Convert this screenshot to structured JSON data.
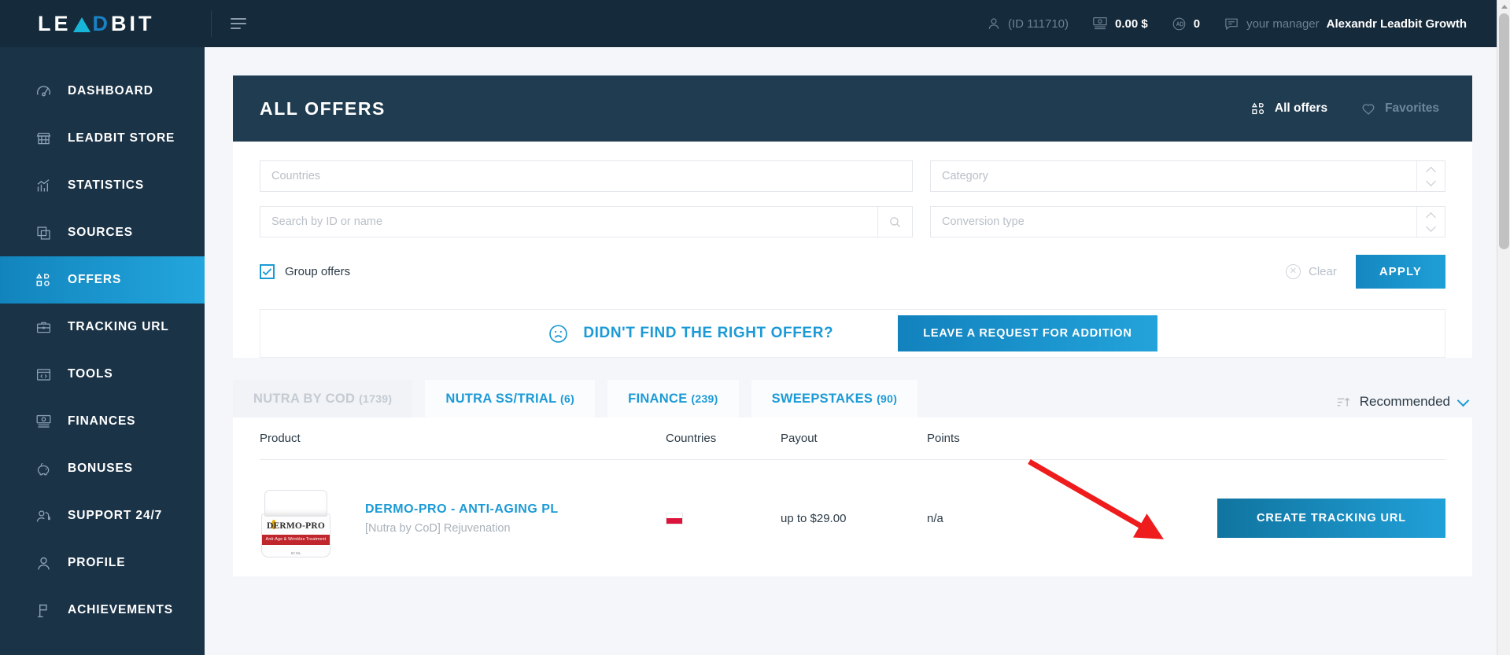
{
  "brand": {
    "name": "LEADBIT",
    "accent": "#17b6d8",
    "accent2": "#1a81c4"
  },
  "topbar": {
    "user_id": "(ID 111710)",
    "balance": "0.00 $",
    "points": "0",
    "manager_label": "your manager",
    "manager_name": "Alexandr Leadbit Growth",
    "icons": {
      "user": "user-icon",
      "money": "banknote-icon",
      "points": "points-icon",
      "chat": "chat-icon",
      "menu": "hamburger-icon"
    }
  },
  "sidebar": {
    "items": [
      {
        "label": "DASHBOARD",
        "icon": "gauge-icon",
        "active": false
      },
      {
        "label": "LEADBIT STORE",
        "icon": "store-icon",
        "active": false
      },
      {
        "label": "STATISTICS",
        "icon": "bar-chart-icon",
        "active": false
      },
      {
        "label": "SOURCES",
        "icon": "layers-icon",
        "active": false
      },
      {
        "label": "OFFERS",
        "icon": "shapes-icon",
        "active": true
      },
      {
        "label": "TRACKING URL",
        "icon": "briefcase-icon",
        "active": false
      },
      {
        "label": "TOOLS",
        "icon": "code-window-icon",
        "active": false
      },
      {
        "label": "FINANCES",
        "icon": "banknote-icon",
        "active": false
      },
      {
        "label": "BONUSES",
        "icon": "piggy-bank-icon",
        "active": false
      },
      {
        "label": "SUPPORT 24/7",
        "icon": "support-agent-icon",
        "active": false
      },
      {
        "label": "PROFILE",
        "icon": "user-icon",
        "active": false
      },
      {
        "label": "ACHIEVEMENTS",
        "icon": "flag-icon",
        "active": false
      }
    ]
  },
  "panel": {
    "title": "ALL OFFERS",
    "all_offers_label": "All offers",
    "favorites_label": "Favorites"
  },
  "filters": {
    "countries_placeholder": "Countries",
    "search_placeholder": "Search by ID or name",
    "category_placeholder": "Category",
    "conversion_placeholder": "Conversion type",
    "group_offers_label": "Group offers",
    "group_offers_checked": true,
    "clear_label": "Clear",
    "apply_label": "APPLY"
  },
  "not_found": {
    "text": "DIDN'T FIND THE RIGHT OFFER?",
    "button": "LEAVE A REQUEST FOR ADDITION",
    "icon": "sad-face-icon"
  },
  "tabs": [
    {
      "label": "NUTRA BY COD",
      "count": "(1739)",
      "active": false,
      "disabled": true
    },
    {
      "label": "NUTRA SS/TRIAL",
      "count": "(6)",
      "active": true,
      "disabled": false
    },
    {
      "label": "FINANCE",
      "count": "(239)",
      "active": false,
      "disabled": false
    },
    {
      "label": "SWEEPSTAKES",
      "count": "(90)",
      "active": false,
      "disabled": false
    }
  ],
  "sort": {
    "label": "Recommended",
    "icon": "sort-ascending-icon"
  },
  "table": {
    "columns": [
      "Product",
      "Countries",
      "Payout",
      "Points"
    ],
    "rows": [
      {
        "name": "DERMO-PRO - ANTI-AGING PL",
        "subtitle": "[Nutra by CoD] Rejuvenation",
        "product_brand": "DERMO-PRO",
        "product_tagline": "Anti-Age & Wrinkles Treatment",
        "product_volume": "50 ML",
        "country": "PL",
        "payout": "up to $29.00",
        "points": "n/a",
        "action": "CREATE TRACKING URL"
      }
    ]
  },
  "annotation": {
    "type": "red-arrow",
    "color": "#ee1c1c"
  }
}
